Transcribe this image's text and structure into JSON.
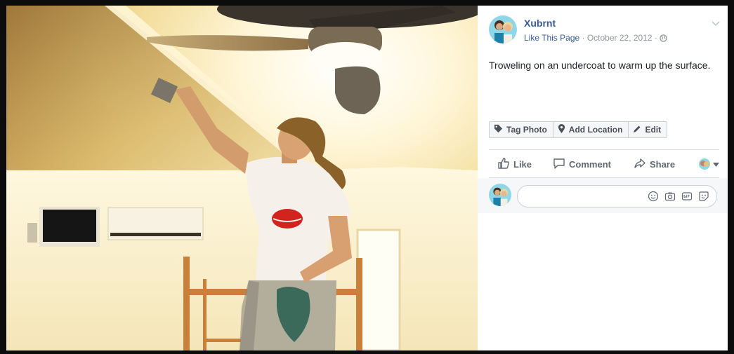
{
  "post": {
    "page_name": "Xubrnt",
    "like_page_label": "Like This Page",
    "separator": " · ",
    "date": "October 22, 2012",
    "audience_icon": "globe-icon",
    "caption": "Troweling on an undercoat to warm up the surface."
  },
  "photo_actions": [
    {
      "label": "Tag Photo",
      "icon": "tag-icon"
    },
    {
      "label": "Add Location",
      "icon": "location-pin-icon"
    },
    {
      "label": "Edit",
      "icon": "pencil-icon"
    }
  ],
  "reactions": {
    "like_label": "Like",
    "comment_label": "Comment",
    "share_label": "Share"
  },
  "comment_box": {
    "icons": [
      "emoji-icon",
      "camera-icon",
      "gif-icon",
      "sticker-icon"
    ]
  },
  "colors": {
    "link": "#365899",
    "meta": "#90949c",
    "text": "#1d2129",
    "panel_bg": "#ffffff",
    "comment_bg": "#f6f7f9"
  }
}
